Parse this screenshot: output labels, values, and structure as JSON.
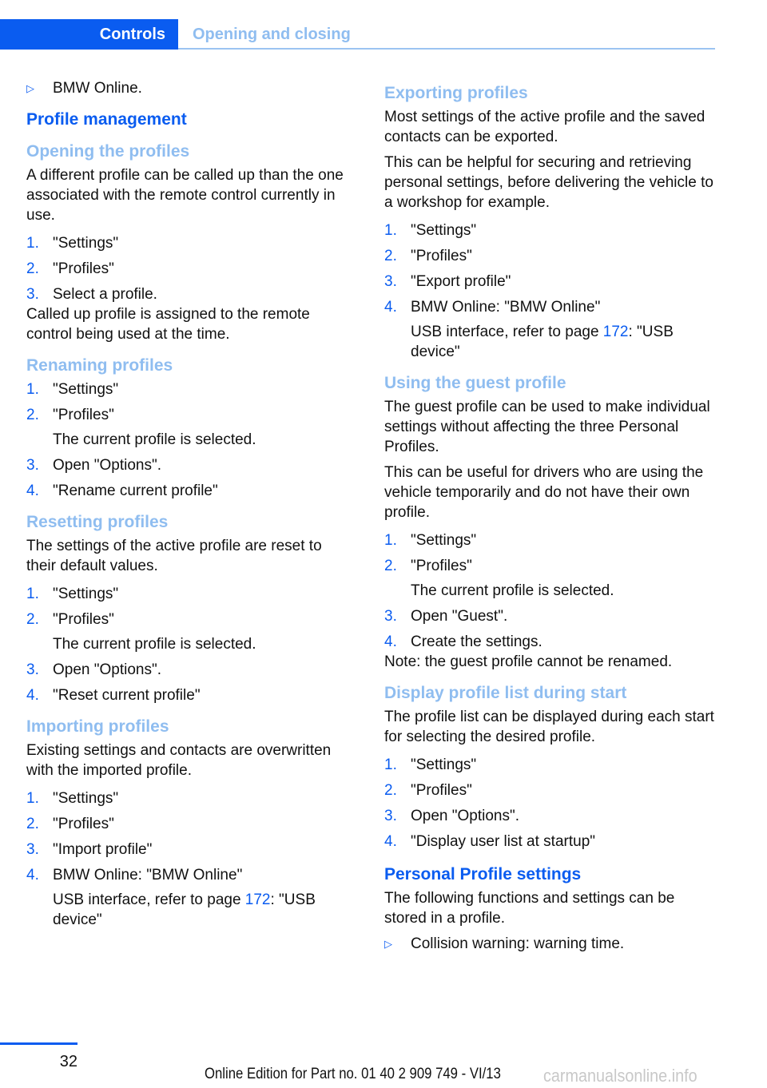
{
  "header": {
    "chapter": "Controls",
    "section": "Opening and closing"
  },
  "left": {
    "intro_bullet": "BMW Online.",
    "h_profile_management": "Profile management",
    "opening": {
      "title": "Opening the profiles",
      "text": "A different profile can be called up than the one associated with the remote control cur­rently in use.",
      "steps": [
        {
          "num": "1.",
          "text": "\"Settings\""
        },
        {
          "num": "2.",
          "text": "\"Profiles\""
        },
        {
          "num": "3.",
          "text": "Select a profile."
        }
      ],
      "after": "Called up profile is assigned to the remote control being used at the time."
    },
    "renaming": {
      "title": "Renaming profiles",
      "steps": [
        {
          "num": "1.",
          "text": "\"Settings\""
        },
        {
          "num": "2.",
          "text": "\"Profiles\"",
          "sub": "The current profile is selected."
        },
        {
          "num": "3.",
          "text": "Open \"Options\"."
        },
        {
          "num": "4.",
          "text": "\"Rename current profile\""
        }
      ]
    },
    "resetting": {
      "title": "Resetting profiles",
      "text": "The settings of the active profile are reset to their default values.",
      "steps": [
        {
          "num": "1.",
          "text": "\"Settings\""
        },
        {
          "num": "2.",
          "text": "\"Profiles\"",
          "sub": "The current profile is selected."
        },
        {
          "num": "3.",
          "text": "Open \"Options\"."
        },
        {
          "num": "4.",
          "text": "\"Reset current profile\""
        }
      ]
    },
    "importing": {
      "title": "Importing profiles",
      "text": "Existing settings and contacts are overwritten with the imported profile.",
      "steps": [
        {
          "num": "1.",
          "text": "\"Settings\""
        },
        {
          "num": "2.",
          "text": "\"Profiles\""
        },
        {
          "num": "3.",
          "text": "\"Import profile\""
        },
        {
          "num": "4.",
          "text": "BMW Online: \"BMW Online\""
        }
      ],
      "sub_pre": "USB interface, refer to page ",
      "sub_link": "172",
      "sub_post": ": \"USB device\""
    }
  },
  "right": {
    "exporting": {
      "title": "Exporting profiles",
      "text1": "Most settings of the active profile and the saved contacts can be exported.",
      "text2": "This can be helpful for securing and retrieving personal settings, before delivering the vehicle to a workshop for example.",
      "steps": [
        {
          "num": "1.",
          "text": "\"Settings\""
        },
        {
          "num": "2.",
          "text": "\"Profiles\""
        },
        {
          "num": "3.",
          "text": "\"Export profile\""
        },
        {
          "num": "4.",
          "text": "BMW Online: \"BMW Online\""
        }
      ],
      "sub_pre": "USB interface, refer to page ",
      "sub_link": "172",
      "sub_post": ": \"USB device\""
    },
    "guest": {
      "title": "Using the guest profile",
      "text1": "The guest profile can be used to make individ­ual settings without affecting the three Per­sonal Profiles.",
      "text2": "This can be useful for drivers who are using the vehicle temporarily and do not have their own profile.",
      "steps": [
        {
          "num": "1.",
          "text": "\"Settings\""
        },
        {
          "num": "2.",
          "text": "\"Profiles\"",
          "sub": "The current profile is selected."
        },
        {
          "num": "3.",
          "text": "Open \"Guest\"."
        },
        {
          "num": "4.",
          "text": "Create the settings."
        }
      ],
      "note": "Note: the guest profile cannot be renamed."
    },
    "display_list": {
      "title": "Display profile list during start",
      "text": "The profile list can be displayed during each start for selecting the desired profile.",
      "steps": [
        {
          "num": "1.",
          "text": "\"Settings\""
        },
        {
          "num": "2.",
          "text": "\"Profiles\""
        },
        {
          "num": "3.",
          "text": "Open \"Options\"."
        },
        {
          "num": "4.",
          "text": "\"Display user list at startup\""
        }
      ]
    },
    "personal": {
      "title": "Personal Profile settings",
      "text": "The following functions and settings can be stored in a profile.",
      "bullet": "Collision warning: warning time."
    }
  },
  "footer": {
    "page_number": "32",
    "edition": "Online Edition for Part no. 01 40 2 909 749 - VI/13",
    "watermark": "carmanualsonline.info"
  },
  "icons": {
    "bullet": "▷"
  }
}
